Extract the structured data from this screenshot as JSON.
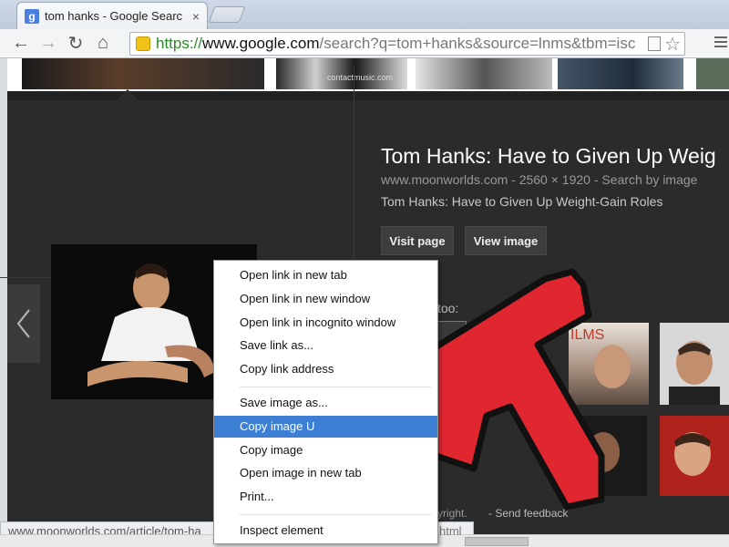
{
  "browser": {
    "tab_title": "tom hanks - Google Searc",
    "favicon": "g",
    "tab_close": "×",
    "url_scheme": "https://",
    "url_host": "www.google.com",
    "url_rest": "/search?q=tom+hanks&source=lnms&tbm=isc"
  },
  "toolbar": {
    "back_icon": "←",
    "forward_icon": "→",
    "reload_icon": "↻",
    "home_icon": "⌂",
    "star_icon": "☆"
  },
  "thumbs": {
    "watermark": "contactmusic.com"
  },
  "info": {
    "title": "Tom Hanks: Have to Given Up Weig",
    "meta": "www.moonworlds.com - 2560 × 1920 - Search by image",
    "subtitle": "Tom Hanks: Have to Given Up Weight-Gain Roles",
    "visit_page": "Visit page",
    "view_image": "View image",
    "related_label": "too:",
    "footer_copyright": "yright.",
    "footer_feedback": "-  Send feedback"
  },
  "status": {
    "url": "www.moonworlds.com/article/tom-ha",
    "url_tail": "html"
  },
  "context_menu": {
    "items": [
      "Open link in new tab",
      "Open link in new window",
      "Open link in incognito window",
      "Save link as...",
      "Copy link address",
      "Save image as...",
      "Copy image U",
      "Copy image",
      "Open image in new tab",
      "Print...",
      "Inspect element"
    ],
    "highlighted_index": 6
  },
  "colors": {
    "highlight": "#3d7fd4",
    "arrow_fill": "#e0262f",
    "panel_bg": "#2b2b2b"
  }
}
